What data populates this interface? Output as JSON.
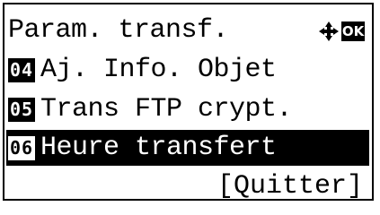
{
  "screen": {
    "title": "Param. transf.",
    "ok_label": "OK",
    "items": [
      {
        "number": "04",
        "label": "Aj. Info. Objet",
        "selected": false
      },
      {
        "number": "05",
        "label": "Trans FTP crypt.",
        "selected": false
      },
      {
        "number": "06",
        "label": "Heure transfert",
        "selected": true
      }
    ],
    "quit_label": "[Quitter]"
  }
}
